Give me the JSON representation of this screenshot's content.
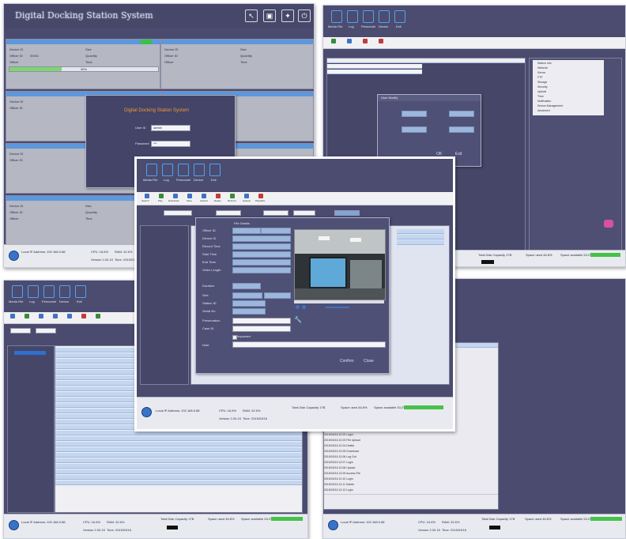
{
  "main_window": {
    "title": "Digital Docking Station System",
    "toolbar_icons": [
      "cursor-icon",
      "monitor-icon",
      "network-icon",
      "power-icon"
    ],
    "panel_fields": {
      "device_id": "Device ID",
      "officer_id": "Officer ID",
      "officer": "Officer",
      "size": "Size",
      "quantity": "Quantity",
      "time": "Time",
      "officer_id_value": "00001",
      "progress_pct": "35%"
    },
    "login": {
      "title": "Digital Docking Station System",
      "user_label": "User ID",
      "user_value": "admin",
      "password_label": "Password",
      "password_value": "***"
    },
    "status": {
      "local_ip": "Local IP Address: 192.168.0.88",
      "cpu": "CPU: 16.6%",
      "ram": "RAM: 32.6%",
      "version": "Version 2.00.15",
      "time": "Time: 2015/03/16"
    }
  },
  "nav": {
    "icons": [
      {
        "icon": "file-icon",
        "label": "Media File"
      },
      {
        "icon": "log-icon",
        "label": "Log"
      },
      {
        "icon": "user-icon",
        "label": "Personnel"
      },
      {
        "icon": "device-icon",
        "label": "Device"
      },
      {
        "icon": "exit-icon",
        "label": "Exit"
      }
    ]
  },
  "tools": [
    "Search",
    "Play",
    "Download",
    "Save",
    "Upload",
    "Delete",
    "Refresh",
    "Upload",
    "Playback"
  ],
  "file_dialog": {
    "title": "File Details",
    "labels": [
      "Officer ID",
      "Device ID",
      "Record Time",
      "Start Time",
      "End Time",
      "Video Length",
      "Duration",
      "Size",
      "Station ID",
      "Serial No",
      "Preservation",
      "Case ID",
      "Note"
    ],
    "important_label": "Important",
    "confirm": "Confirm",
    "close": "Close"
  },
  "user_dialog": {
    "title": "User Modify",
    "confirm": "OK",
    "close": "Exit"
  },
  "storage": {
    "total": "Total Disk Capacity 1TB",
    "used": "Space used 46.8%",
    "available": "Space available 53.2%"
  },
  "log_entries": [
    "2015/03/16 12:00 Access File",
    "2015/03/16 12:01 Log Out",
    "2015/03/16 12:02 Login",
    "2015/03/16 12:03 File Upload",
    "2015/03/16 12:04 Delete",
    "2015/03/16 12:05 Download",
    "2015/03/16 12:06 Log Out",
    "2015/03/16 12:07 Login",
    "2015/03/16 12:08 Upload",
    "2015/03/16 12:09 Access File",
    "2015/03/16 12:10 Login",
    "2015/03/16 12:11 Delete",
    "2015/03/16 12:12 Login"
  ],
  "settings_tree": [
    "Station Info",
    "Network",
    "Server",
    "FTP",
    "Storage",
    "Security",
    "Upload",
    "Time",
    "Notification",
    "Device Management",
    "Advanced"
  ]
}
